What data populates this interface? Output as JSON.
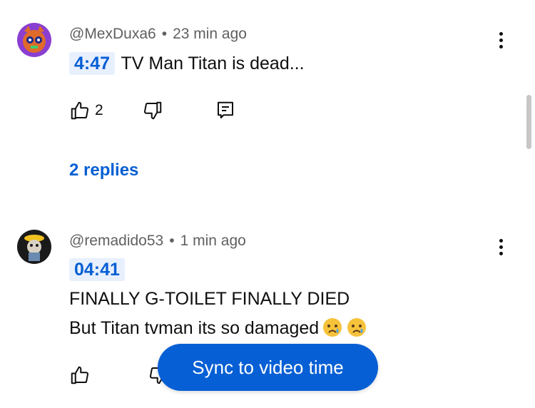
{
  "comments": [
    {
      "author": "@MexDuxa6",
      "time": "23 min ago",
      "timestamp": "4:47",
      "text": "TV Man Titan is dead...",
      "likes": "2",
      "replies_label": "2 replies"
    },
    {
      "author": "@remadido53",
      "time": "1 min ago",
      "timestamp": "04:41",
      "line1": "FINALLY G-TOILET FINALLY DIED",
      "line2": "But Titan tvman its so damaged",
      "emoji": "crying-face"
    }
  ],
  "separator": "•",
  "sync_button": "Sync to video time",
  "colors": {
    "link": "#065fd4",
    "timestamp_bg": "#e8f0fe",
    "meta": "#606060",
    "sync_bg": "#065fd4"
  },
  "icons": [
    "like-icon",
    "dislike-icon",
    "reply-icon",
    "more-options-icon"
  ]
}
